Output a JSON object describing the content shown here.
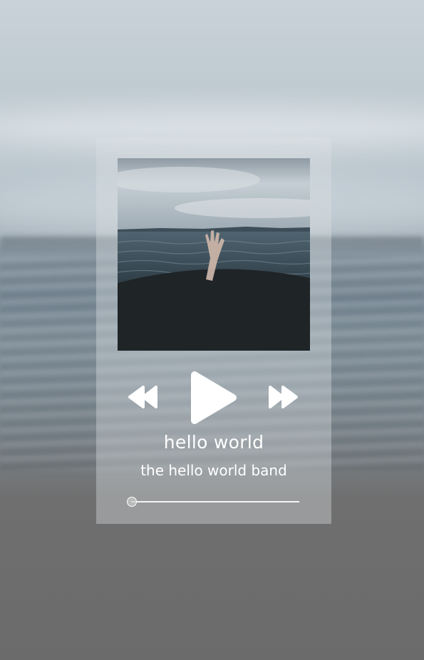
{
  "player": {
    "song_title": "hello world",
    "artist_name": "the hello world band",
    "progress_fraction": 0.0
  },
  "icons": {
    "previous": "rewind-icon",
    "play": "play-icon",
    "next": "fast-forward-icon"
  },
  "colors": {
    "icon": "#ffffff",
    "text": "#ffffff",
    "card": "rgba(220,226,230,0.38)"
  }
}
